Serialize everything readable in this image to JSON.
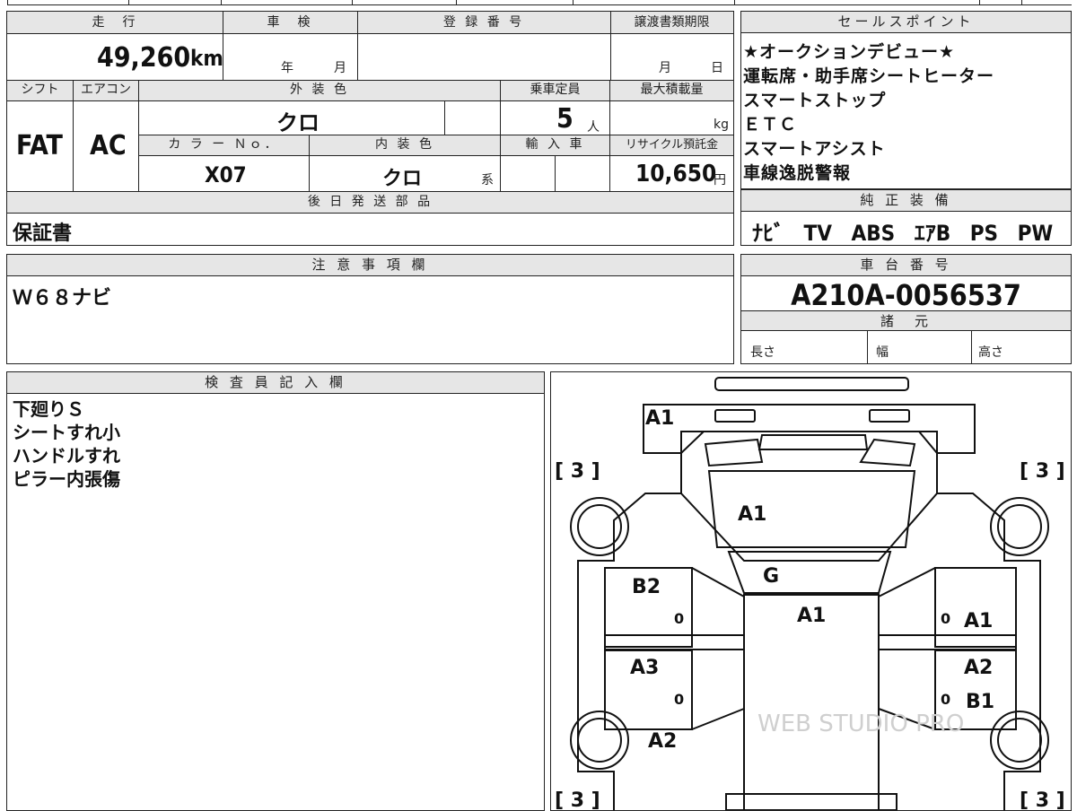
{
  "header": {
    "mileage_label": "走　行",
    "mileage_value": "49,260",
    "mileage_unit": "km",
    "inspection_label": "車　検",
    "inspection_year": "年",
    "inspection_month": "月",
    "registration_label": "登 録 番 号",
    "transfer_label": "譲渡書類期限",
    "transfer_month": "月",
    "transfer_day": "日",
    "shift_label": "シフト",
    "shift_value": "FAT",
    "ac_label": "エアコン",
    "ac_value": "AC",
    "exterior_label": "外 装 色",
    "exterior_value": "クロ",
    "capacity_label": "乗車定員",
    "capacity_value": "5",
    "capacity_unit": "人",
    "maxload_label": "最大積載量",
    "maxload_unit": "kg",
    "color_no_label": "カ ラ ー Ｎｏ．",
    "color_no_value": "X07",
    "interior_label": "内 装 色",
    "interior_value": "クロ",
    "interior_suffix": "系",
    "import_label": "輸 入 車",
    "recycle_label": "リサイクル預託金",
    "recycle_value": "10,650",
    "recycle_unit": "円",
    "later_parts_label": "後 日 発 送 部 品",
    "later_parts_value": "保証書"
  },
  "sales_points": {
    "label": "セールスポイント",
    "items": [
      "★オークションデビュー★",
      "運転席・助手席シートヒーター",
      "スマートストップ",
      "ＥＴＣ",
      "スマートアシスト",
      "車線逸脱警報"
    ]
  },
  "equipment": {
    "label": "純 正 装 備",
    "items": [
      "ﾅﾋﾞ",
      "TV",
      "ABS",
      "ｴｱB",
      "PS",
      "PW"
    ]
  },
  "notes": {
    "label": "注 意 事 項 欄",
    "value": "Ｗ６８ナビ"
  },
  "chassis": {
    "label": "車 台 番 号",
    "value": "A210A-0056537",
    "spec_label": "諸　元",
    "length_label": "長さ",
    "width_label": "幅",
    "height_label": "高さ"
  },
  "inspector": {
    "label": "検 査 員 記 入 欄",
    "lines": [
      "下廻りＳ",
      "シートすれ小",
      "ハンドルすれ",
      "ピラー内張傷"
    ]
  },
  "diagram": {
    "marks": {
      "front_bumper": "A1",
      "hood": "A1",
      "windshield": "G",
      "roof": "A1",
      "left_front_door": "B2",
      "left_rear_door": "A3",
      "left_rear_fender": "A2",
      "right_front_door": "A1",
      "right_rear_door_1": "A2",
      "right_rear_door_2": "B1"
    },
    "tire_front_left": "[ 3 ]",
    "tire_front_right": "[ 3 ]",
    "tire_rear_left": "[ 3 ]",
    "tire_rear_right": "[ 3 ]",
    "zero": "0",
    "watermark": "WEB STUDIO PRO"
  }
}
